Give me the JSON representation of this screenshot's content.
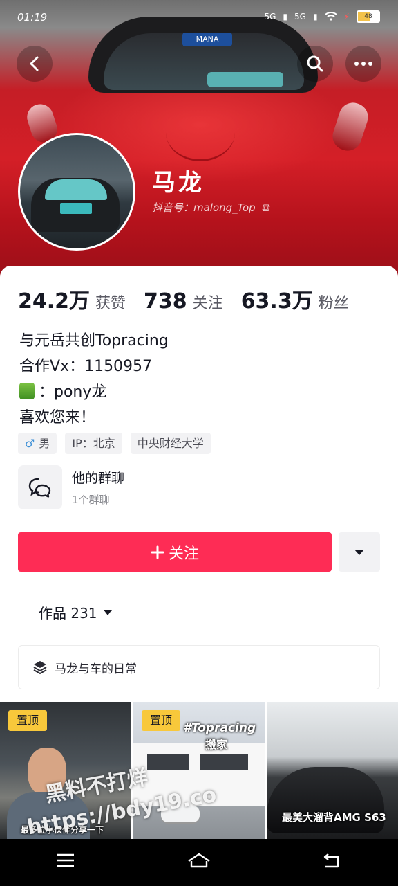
{
  "status_bar": {
    "time": "01:19",
    "net1": "5G",
    "net2": "5G",
    "battery": "48"
  },
  "header": {
    "back_icon": "back-arrow-icon",
    "search_icon": "search-icon",
    "more_icon": "more-icon"
  },
  "profile": {
    "name": "马龙",
    "douyin_id_label": "抖音号：malong_Top"
  },
  "banner_sign": "MANA",
  "stats": [
    {
      "value": "24.2万",
      "label": "获赞"
    },
    {
      "value": "738",
      "label": "关注"
    },
    {
      "value": "63.3万",
      "label": "粉丝"
    }
  ],
  "bio": [
    "与元岳共创Topracing",
    "合作Vx：1150957",
    "：pony龙",
    "喜欢您来！"
  ],
  "tags": [
    {
      "icon": "♂",
      "label": "男"
    },
    {
      "label": "IP：北京"
    },
    {
      "label": "中央财经大学"
    }
  ],
  "group_chat": {
    "title": "他的群聊",
    "subtitle": "1个群聊"
  },
  "follow_button": {
    "label": "关注"
  },
  "works_tab": {
    "label": "作品 231"
  },
  "collection": {
    "label": "马龙与车的日常"
  },
  "thumbnails": [
    {
      "pin": "置顶",
      "caption": "最多位小伙伴分享一下"
    },
    {
      "pin": "置顶",
      "title": "#Topracing",
      "subtitle": "搬家"
    },
    {
      "caption": "最美大溜背AMG S63"
    }
  ],
  "watermark": {
    "line1": "黑料不打烊",
    "line2": "https://bdy19.co"
  },
  "colors": {
    "accent": "#fe2c55",
    "pin": "#f8c83b",
    "banner": "#d41f27"
  }
}
